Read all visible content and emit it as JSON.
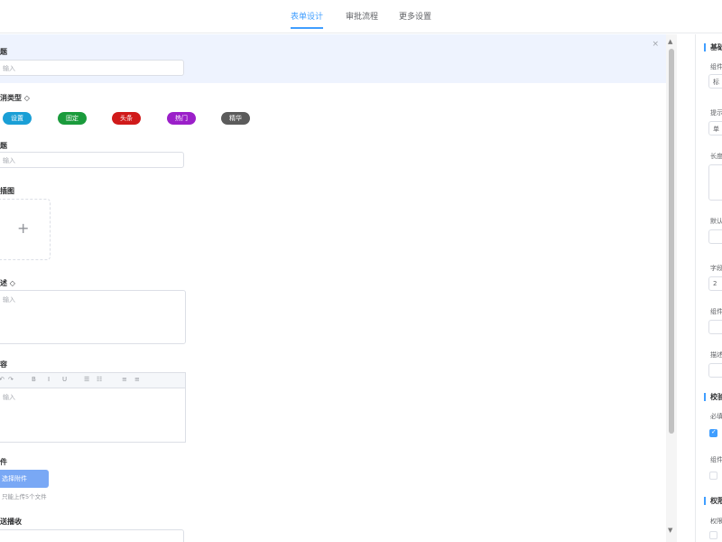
{
  "tabs": [
    {
      "label": "表单设计",
      "active": true
    },
    {
      "label": "审批流程",
      "active": false
    },
    {
      "label": "更多设置",
      "active": false
    }
  ],
  "form": {
    "fields": [
      {
        "label": "题",
        "placeholder": "输入",
        "selected": true
      },
      {
        "label": "消类型 ◇",
        "type": "tags"
      },
      {
        "label": "题",
        "placeholder": "输入"
      },
      {
        "label": "插图"
      },
      {
        "label": "述 ◇",
        "placeholder": "输入"
      },
      {
        "label": "容",
        "placeholder": "输入"
      },
      {
        "label": "件",
        "button": "选择附件",
        "tip": "只能上传5个文件"
      },
      {
        "label": "送播收"
      }
    ],
    "tags": [
      {
        "label": "设置",
        "color": "#1a9fd6"
      },
      {
        "label": "固定",
        "color": "#1a9b3c"
      },
      {
        "label": "头条",
        "color": "#d01a1a"
      },
      {
        "label": "热门",
        "color": "#9b1fc9"
      },
      {
        "label": "精华",
        "color": "#5b5b5b"
      }
    ],
    "editor_toolbar": [
      "↶",
      "↷",
      "B",
      "I",
      "U",
      "☰",
      "☷",
      "≡",
      "≡"
    ],
    "upload_plus": "+",
    "close_icon_glyph": "×"
  },
  "scroll": {
    "up": "▲",
    "down": "▼"
  },
  "right_panel": {
    "section1": "基础",
    "labels": [
      "组件",
      "提示",
      "长度",
      "默认",
      "字段",
      "组件",
      "描述"
    ],
    "input_value_1": "标",
    "input_value_2": "单",
    "input_value_3": "2",
    "section2": "校验",
    "labels2": [
      "必填",
      "组件"
    ],
    "section3": "权限",
    "labels3": [
      "权限"
    ]
  }
}
